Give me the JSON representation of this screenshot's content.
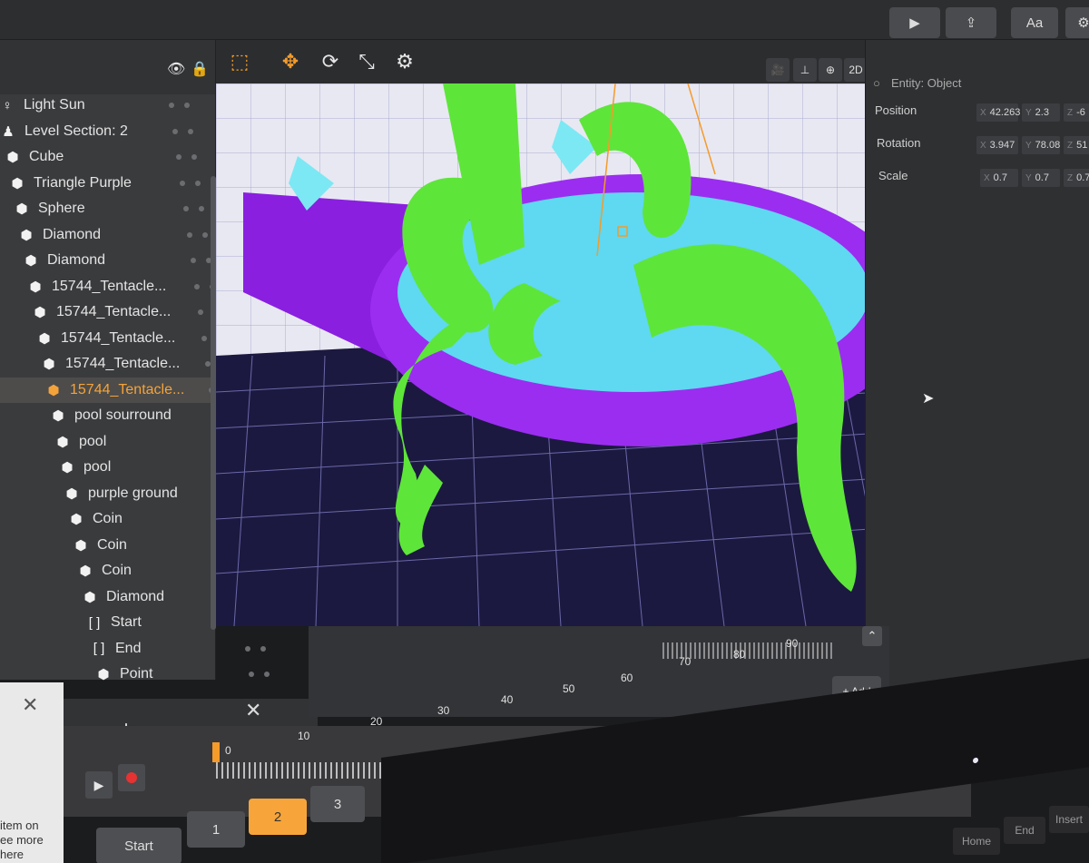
{
  "toolbar": {
    "play_icon": "play-icon",
    "share_icon": "export-icon",
    "font_label": "Aa"
  },
  "outliner": {
    "items": [
      {
        "label": "Light Sun",
        "icon": "light-icon"
      },
      {
        "label": "Level Section: 2",
        "icon": "section-icon"
      },
      {
        "label": "Cube",
        "icon": "hexagon-icon"
      },
      {
        "label": "Triangle Purple",
        "icon": "hexagon-icon"
      },
      {
        "label": "Sphere",
        "icon": "hexagon-icon"
      },
      {
        "label": "Diamond",
        "icon": "hexagon-icon"
      },
      {
        "label": "Diamond",
        "icon": "hexagon-icon"
      },
      {
        "label": "15744_Tentacle...",
        "icon": "hexagon-icon"
      },
      {
        "label": "15744_Tentacle...",
        "icon": "hexagon-icon"
      },
      {
        "label": "15744_Tentacle...",
        "icon": "hexagon-icon"
      },
      {
        "label": "15744_Tentacle...",
        "icon": "hexagon-icon"
      },
      {
        "label": "15744_Tentacle...",
        "icon": "hexagon-icon",
        "selected": true
      },
      {
        "label": "pool sourround",
        "icon": "hexagon-icon"
      },
      {
        "label": "pool",
        "icon": "hexagon-icon"
      },
      {
        "label": "pool",
        "icon": "hexagon-icon"
      },
      {
        "label": "purple ground",
        "icon": "hexagon-icon"
      },
      {
        "label": "Coin",
        "icon": "hexagon-icon"
      },
      {
        "label": "Coin",
        "icon": "hexagon-icon"
      },
      {
        "label": "Coin",
        "icon": "hexagon-icon"
      },
      {
        "label": "Diamond",
        "icon": "hexagon-icon"
      },
      {
        "label": "Start",
        "icon": "bracket-icon"
      },
      {
        "label": "End",
        "icon": "bracket-icon"
      },
      {
        "label": "Point",
        "icon": "hexagon-icon"
      }
    ]
  },
  "hint": {
    "text": "item on\nee more\nhere"
  },
  "viewport_toolbar": {
    "view_2d_label": "2D"
  },
  "properties": {
    "entity_label": "Entity: Object",
    "position_label": "Position",
    "rotation_label": "Rotation",
    "scale_label": "Scale",
    "position": {
      "x": "42.263",
      "y": "2.3",
      "z": "-6"
    },
    "rotation": {
      "x": "3.947",
      "y": "78.08",
      "z": "51"
    },
    "scale": {
      "x": "0.7",
      "y": "0.7",
      "z": "0.7"
    }
  },
  "timeline": {
    "upper_ticks": [
      "70",
      "80",
      "90"
    ],
    "lower_ticks": [
      "0",
      "10",
      "20",
      "30",
      "40",
      "50",
      "60"
    ],
    "add_label": "+ Add"
  },
  "scenes": {
    "start_label": "Start",
    "buttons": [
      "1",
      "2",
      "3"
    ],
    "active": "2"
  },
  "keyboard": {
    "keys": [
      "Home",
      "End",
      "Insert"
    ]
  },
  "colors": {
    "accent": "#f49b2a",
    "tentacle": "#5ee53a",
    "pool": "#5fd8f2",
    "ground": "#8a1fe0",
    "grid_bg": "#1e1a4a"
  }
}
